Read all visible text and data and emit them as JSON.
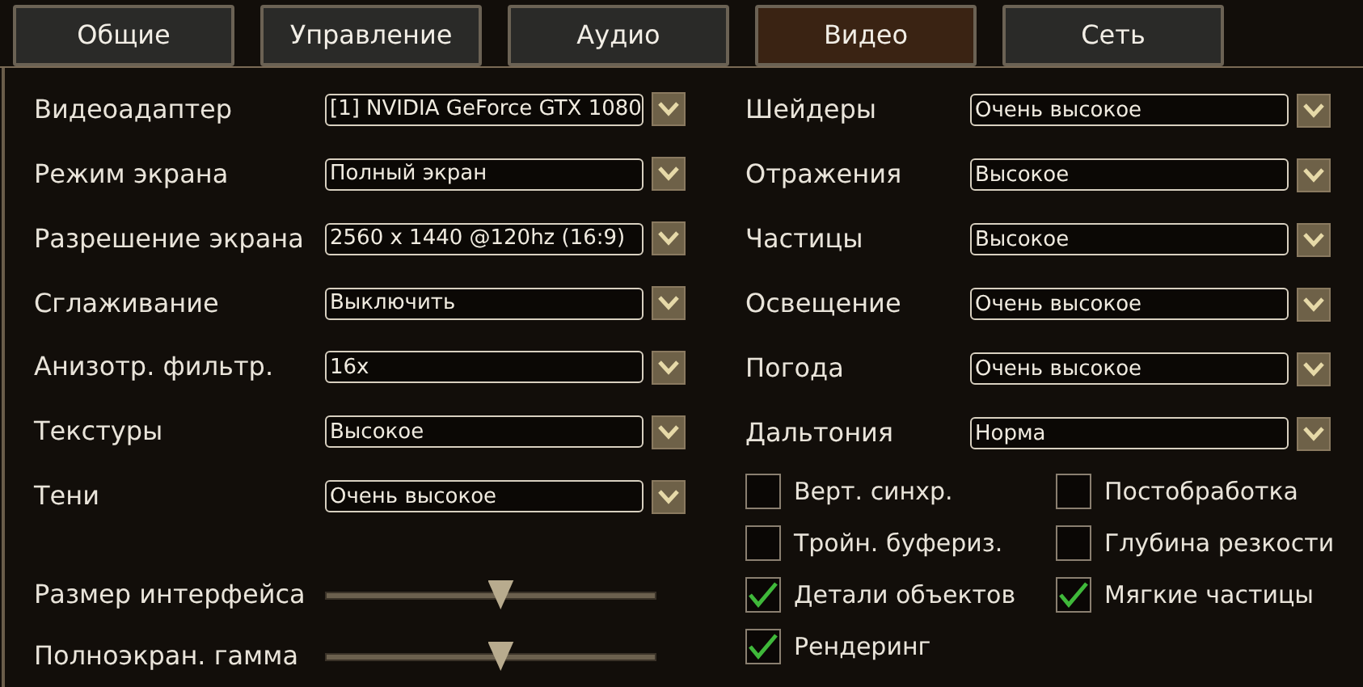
{
  "tabs": [
    {
      "label": "Общие",
      "selected": false
    },
    {
      "label": "Управление",
      "selected": false
    },
    {
      "label": "Аудио",
      "selected": false
    },
    {
      "label": "Видео",
      "selected": true
    },
    {
      "label": "Сеть",
      "selected": false
    }
  ],
  "left_settings": [
    {
      "label": "Видеоадаптер",
      "value": "[1] NVIDIA GeForce GTX 1080"
    },
    {
      "label": "Режим экрана",
      "value": "Полный экран"
    },
    {
      "label": "Разрешение экрана",
      "value": "2560 x 1440 @120hz (16:9)"
    },
    {
      "label": "Сглаживание",
      "value": "Выключить"
    },
    {
      "label": "Анизотр. фильтр.",
      "value": "16x"
    },
    {
      "label": "Текстуры",
      "value": "Высокое"
    },
    {
      "label": "Тени",
      "value": "Очень высокое"
    }
  ],
  "sliders": [
    {
      "label": "Размер интерфейса",
      "level": 0.53
    },
    {
      "label": "Полноэкран. гамма",
      "level": 0.53
    }
  ],
  "right_settings": [
    {
      "label": "Шейдеры",
      "value": "Очень высокое"
    },
    {
      "label": "Отражения",
      "value": "Высокое"
    },
    {
      "label": "Частицы",
      "value": "Высокое"
    },
    {
      "label": "Освещение",
      "value": "Очень высокое"
    },
    {
      "label": "Погода",
      "value": "Очень высокое"
    },
    {
      "label": "Дальтония",
      "value": "Норма"
    }
  ],
  "checkboxes": [
    {
      "label": "Верт. синхр.",
      "checked": false
    },
    {
      "label": "Постобработка",
      "checked": false
    },
    {
      "label": "Тройн. буфериз.",
      "checked": false
    },
    {
      "label": "Глубина резкости",
      "checked": false
    },
    {
      "label": "Детали объектов",
      "checked": true
    },
    {
      "label": "Мягкие частицы",
      "checked": true
    },
    {
      "label": "Рендеринг",
      "checked": true
    }
  ]
}
